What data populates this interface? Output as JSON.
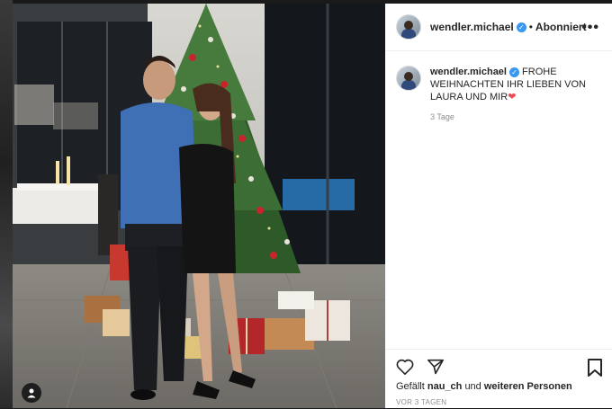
{
  "post": {
    "username": "wendler.michael",
    "verified_badge": "✓",
    "separator": "•",
    "follow_status": "Abonniert",
    "more_icon": "more-horizontal-icon",
    "more_glyph": "•••",
    "caption_username": "wendler.michael",
    "caption_text": "FROHE WEIHNACHTEN IHR LIEBEN VON LAURA UND MIR",
    "caption_emoji": "❤",
    "caption_time": "3 Tage",
    "likes_prefix": "Gefällt",
    "likes_user": "nau_ch",
    "likes_and": "und",
    "likes_others": "weiteren Personen",
    "date": "VOR 3 TAGEN"
  },
  "colors": {
    "accent_blue": "#3897f0",
    "heart_red": "#ed4956",
    "text_dark": "#262626",
    "text_muted": "#8e8e8e"
  }
}
